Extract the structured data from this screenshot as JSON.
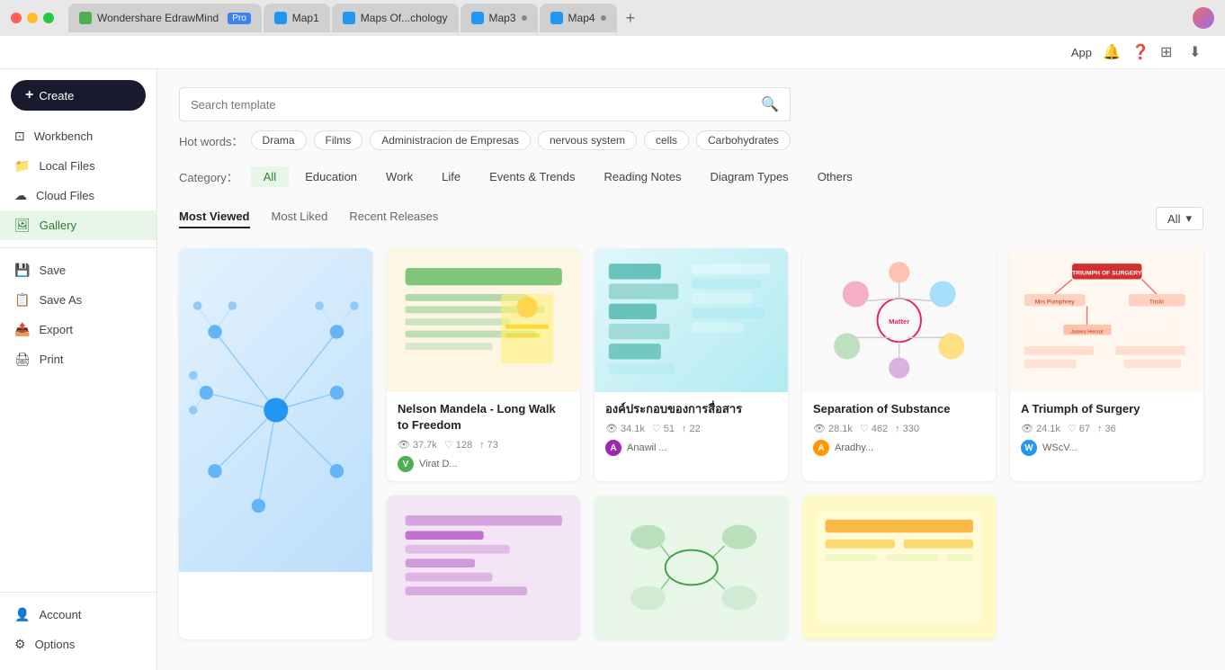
{
  "titlebar": {
    "tabs": [
      {
        "label": "Wondershare EdrawMind",
        "badge": "Pro",
        "icon": "mind",
        "active": false
      },
      {
        "label": "Map1",
        "icon": "blue",
        "active": false
      },
      {
        "label": "Maps Of...chology",
        "icon": "blue",
        "active": false
      },
      {
        "label": "Map3",
        "icon": "blue",
        "dot": true,
        "active": false
      },
      {
        "label": "Map4",
        "icon": "blue",
        "dot": true,
        "active": false
      }
    ]
  },
  "sidebar": {
    "create_label": "Create",
    "items": [
      {
        "id": "workbench",
        "label": "Workbench",
        "icon": "grid"
      },
      {
        "id": "local-files",
        "label": "Local Files",
        "icon": "folder"
      },
      {
        "id": "cloud-files",
        "label": "Cloud Files",
        "icon": "cloud"
      },
      {
        "id": "gallery",
        "label": "Gallery",
        "icon": "gallery",
        "active": true
      }
    ],
    "actions": [
      {
        "id": "save",
        "label": "Save",
        "icon": "save"
      },
      {
        "id": "save-as",
        "label": "Save As",
        "icon": "save-as"
      },
      {
        "id": "export",
        "label": "Export",
        "icon": "export"
      },
      {
        "id": "print",
        "label": "Print",
        "icon": "print"
      }
    ],
    "bottom": [
      {
        "id": "account",
        "label": "Account",
        "icon": "account"
      },
      {
        "id": "options",
        "label": "Options",
        "icon": "settings"
      }
    ]
  },
  "toolbar": {
    "app_label": "App",
    "icons": [
      "bell",
      "help",
      "grid",
      "share"
    ]
  },
  "search": {
    "placeholder": "Search template",
    "hot_words_label": "Hot words：",
    "tags": [
      "Drama",
      "Films",
      "Administracion de Empresas",
      "nervous system",
      "cells",
      "Carbohydrates"
    ]
  },
  "categories": {
    "label": "Category：",
    "items": [
      "All",
      "Education",
      "Work",
      "Life",
      "Events & Trends",
      "Reading Notes",
      "Diagram Types",
      "Others"
    ],
    "active": "All"
  },
  "sort": {
    "tabs": [
      "Most Viewed",
      "Most Liked",
      "Recent Releases"
    ],
    "active": "Most Viewed",
    "filter_label": "All",
    "filter_icon": "chevron-down"
  },
  "cards": [
    {
      "id": "card-1",
      "title": "",
      "thumb_color": "blue",
      "stats": null,
      "author": null,
      "large": true
    },
    {
      "id": "card-2",
      "title": "Nelson Mandela - Long Walk to Freedom",
      "thumb_color": "beige",
      "stats": {
        "views": "37.7k",
        "likes": "128",
        "shares": "73"
      },
      "author": {
        "name": "Virat D...",
        "color": "#4CAF50",
        "initial": "V"
      }
    },
    {
      "id": "card-3",
      "title": "องค์ประกอบของการสื่อสาร",
      "thumb_color": "teal",
      "stats": {
        "views": "34.1k",
        "likes": "51",
        "shares": "22"
      },
      "author": {
        "name": "Anawil ...",
        "color": "#9C27B0",
        "initial": "A"
      }
    },
    {
      "id": "card-4",
      "title": "Separation of Substance",
      "thumb_color": "white",
      "stats": {
        "views": "28.1k",
        "likes": "462",
        "shares": "330"
      },
      "author": {
        "name": "Aradhy...",
        "color": "#FF9800",
        "initial": "A"
      }
    },
    {
      "id": "card-5",
      "title": "A Triumph of Surgery",
      "thumb_color": "red",
      "stats": {
        "views": "24.1k",
        "likes": "67",
        "shares": "36"
      },
      "author": {
        "name": "WScV...",
        "color": "#2196F3",
        "initial": "W"
      }
    }
  ]
}
